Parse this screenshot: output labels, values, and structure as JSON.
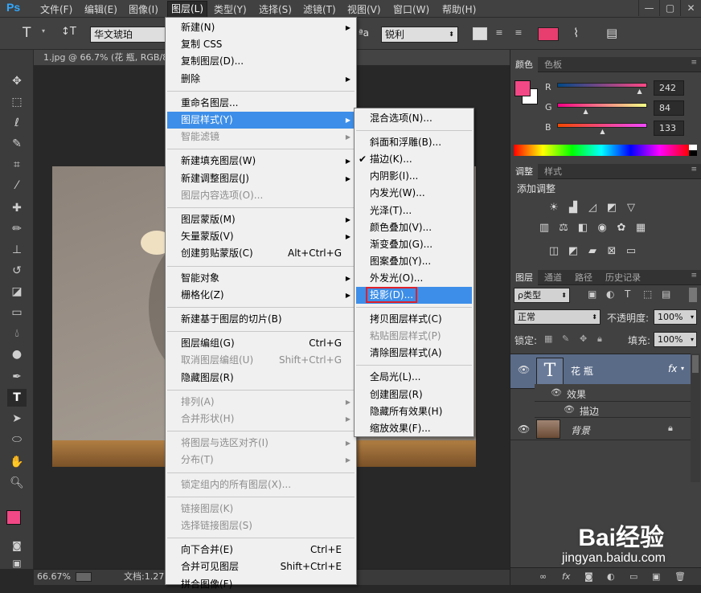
{
  "app": {
    "logo": "Ps"
  },
  "menubar": {
    "items": [
      "文件(F)",
      "编辑(E)",
      "图像(I)",
      "图层(L)",
      "类型(Y)",
      "选择(S)",
      "滤镜(T)",
      "视图(V)",
      "窗口(W)",
      "帮助(H)"
    ],
    "open_index": 3
  },
  "window_controls": [
    "—",
    "▢",
    "✕"
  ],
  "options_bar": {
    "tool_glyph": "T",
    "orient_glyph": "↕T",
    "font_family": "华文琥珀",
    "aa_label": "ªa",
    "antialias": "锐利",
    "color": "#e83d6f"
  },
  "document": {
    "tab_title": "1.jpg @ 66.7% (花 瓶, RGB/8",
    "zoom": "66.67%",
    "doc_info": "文档:1.27"
  },
  "layer_menu": [
    {
      "label": "新建(N)",
      "sub": true
    },
    {
      "label": "复制 CSS"
    },
    {
      "label": "复制图层(D)..."
    },
    {
      "label": "删除",
      "sub": true
    },
    {
      "sep": true
    },
    {
      "label": "重命名图层..."
    },
    {
      "label": "图层样式(Y)",
      "sub": true,
      "highlight": true
    },
    {
      "label": "智能滤镜",
      "sub": true,
      "disabled": true
    },
    {
      "sep": true
    },
    {
      "label": "新建填充图层(W)",
      "sub": true
    },
    {
      "label": "新建调整图层(J)",
      "sub": true
    },
    {
      "label": "图层内容选项(O)...",
      "disabled": true
    },
    {
      "sep": true
    },
    {
      "label": "图层蒙版(M)",
      "sub": true
    },
    {
      "label": "矢量蒙版(V)",
      "sub": true
    },
    {
      "label": "创建剪贴蒙版(C)",
      "shortcut": "Alt+Ctrl+G"
    },
    {
      "sep": true
    },
    {
      "label": "智能对象",
      "sub": true
    },
    {
      "label": "栅格化(Z)",
      "sub": true
    },
    {
      "sep": true
    },
    {
      "label": "新建基于图层的切片(B)"
    },
    {
      "sep": true
    },
    {
      "label": "图层编组(G)",
      "shortcut": "Ctrl+G"
    },
    {
      "label": "取消图层编组(U)",
      "shortcut": "Shift+Ctrl+G",
      "disabled": true
    },
    {
      "label": "隐藏图层(R)"
    },
    {
      "sep": true
    },
    {
      "label": "排列(A)",
      "sub": true,
      "disabled": true
    },
    {
      "label": "合并形状(H)",
      "sub": true,
      "disabled": true
    },
    {
      "sep": true
    },
    {
      "label": "将图层与选区对齐(I)",
      "sub": true,
      "disabled": true
    },
    {
      "label": "分布(T)",
      "sub": true,
      "disabled": true
    },
    {
      "sep": true
    },
    {
      "label": "锁定组内的所有图层(X)...",
      "disabled": true
    },
    {
      "sep": true
    },
    {
      "label": "链接图层(K)",
      "disabled": true
    },
    {
      "label": "选择链接图层(S)",
      "disabled": true
    },
    {
      "sep": true
    },
    {
      "label": "向下合并(E)",
      "shortcut": "Ctrl+E"
    },
    {
      "label": "合并可见图层",
      "shortcut": "Shift+Ctrl+E"
    },
    {
      "label": "拼合图像(F)"
    }
  ],
  "style_submenu": [
    {
      "label": "混合选项(N)..."
    },
    {
      "sep": true
    },
    {
      "label": "斜面和浮雕(B)..."
    },
    {
      "label": "描边(K)...",
      "checked": true
    },
    {
      "label": "内阴影(I)..."
    },
    {
      "label": "内发光(W)..."
    },
    {
      "label": "光泽(T)..."
    },
    {
      "label": "颜色叠加(V)..."
    },
    {
      "label": "渐变叠加(G)..."
    },
    {
      "label": "图案叠加(Y)..."
    },
    {
      "label": "外发光(O)..."
    },
    {
      "label": "投影(D)...",
      "highlight": true
    },
    {
      "sep": true
    },
    {
      "label": "拷贝图层样式(C)"
    },
    {
      "label": "粘贴图层样式(P)",
      "disabled": true
    },
    {
      "label": "清除图层样式(A)"
    },
    {
      "sep": true
    },
    {
      "label": "全局光(L)..."
    },
    {
      "label": "创建图层(R)"
    },
    {
      "label": "隐藏所有效果(H)"
    },
    {
      "label": "缩放效果(F)..."
    }
  ],
  "color_panel": {
    "tabs": [
      "颜色",
      "色板"
    ],
    "fg": "#f24885",
    "bg": "#ffffff",
    "channels": [
      {
        "label": "R",
        "value": "242",
        "level": 0.949
      },
      {
        "label": "G",
        "value": "84",
        "level": 0.329
      },
      {
        "label": "B",
        "value": "133",
        "level": 0.522
      }
    ]
  },
  "adjust_panel": {
    "tabs": [
      "调整",
      "样式"
    ],
    "title": "添加调整"
  },
  "layers_panel": {
    "tabs": [
      "图层",
      "通道",
      "路径",
      "历史记录"
    ],
    "filter": "ρ类型",
    "blend_mode": "正常",
    "opacity_label": "不透明度:",
    "opacity": "100%",
    "lock_label": "锁定:",
    "fill_label": "填充:",
    "fill": "100%",
    "layers": [
      {
        "name": "花 瓶",
        "type": "text",
        "fx": "fx",
        "effects_label": "效果",
        "effects": [
          "描边"
        ]
      },
      {
        "name": "背景",
        "type": "image"
      }
    ]
  },
  "watermark": {
    "brand": "Bai经验",
    "url": "jingyan.baidu.com"
  }
}
